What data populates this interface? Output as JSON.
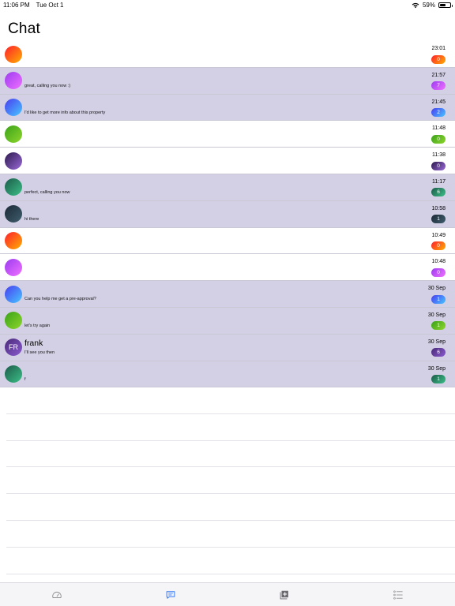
{
  "status_bar": {
    "time": "11:06 PM",
    "date": "Tue Oct 1",
    "battery": "59%",
    "battery_level": 0.59,
    "wifi_icon": "wifi-icon"
  },
  "page": {
    "title": "Chat"
  },
  "colors": {
    "unread_row": "#d3d0e5",
    "read_row": "#ffffff",
    "tab_active": "#3478f6",
    "tab_inactive": "#8e8e93"
  },
  "chats": [
    {
      "avatar_text": "",
      "name": "",
      "preview": "",
      "time": "23:01",
      "badge": "0",
      "unread": false,
      "gradient": "g1"
    },
    {
      "avatar_text": "",
      "name": "",
      "preview": "great, calling you now :)",
      "time": "21:57",
      "badge": "7",
      "unread": true,
      "gradient": "g2"
    },
    {
      "avatar_text": "",
      "name": "",
      "preview": "I'd like to get more info about this property",
      "time": "21:45",
      "badge": "2",
      "unread": true,
      "gradient": "g3"
    },
    {
      "avatar_text": "",
      "name": "",
      "preview": "",
      "time": "11:48",
      "badge": "0",
      "unread": false,
      "gradient": "g4"
    },
    {
      "avatar_text": "",
      "name": "",
      "preview": "",
      "time": "11:38",
      "badge": "0",
      "unread": false,
      "gradient": "g5"
    },
    {
      "avatar_text": "",
      "name": "",
      "preview": "perfect, calling you now",
      "time": "11:17",
      "badge": "6",
      "unread": true,
      "gradient": "g6"
    },
    {
      "avatar_text": "",
      "name": "",
      "preview": "hi there",
      "time": "10:58",
      "badge": "1",
      "unread": true,
      "gradient": "g7"
    },
    {
      "avatar_text": "",
      "name": "",
      "preview": "",
      "time": "10:49",
      "badge": "0",
      "unread": false,
      "gradient": "g1"
    },
    {
      "avatar_text": "",
      "name": "",
      "preview": "",
      "time": "10:48",
      "badge": "0",
      "unread": false,
      "gradient": "g2"
    },
    {
      "avatar_text": "",
      "name": "",
      "preview": "Can you help me get a pre-approval?",
      "time": "30 Sep",
      "badge": "1",
      "unread": true,
      "gradient": "g3"
    },
    {
      "avatar_text": "",
      "name": "",
      "preview": "let's try again",
      "time": "30 Sep",
      "badge": "1",
      "unread": true,
      "gradient": "g4"
    },
    {
      "avatar_text": "FR",
      "name": "frank",
      "preview": "I'll see you then",
      "time": "30 Sep",
      "badge": "6",
      "unread": true,
      "gradient": "g8"
    },
    {
      "avatar_text": "",
      "name": "",
      "preview": "f",
      "time": "30 Sep",
      "badge": "1",
      "unread": true,
      "gradient": "g6"
    }
  ],
  "tabs": [
    {
      "icon": "speedometer-icon",
      "active": false
    },
    {
      "icon": "chat-bubble-icon",
      "active": true
    },
    {
      "icon": "add-listing-icon",
      "active": false
    },
    {
      "icon": "list-icon",
      "active": false
    }
  ]
}
